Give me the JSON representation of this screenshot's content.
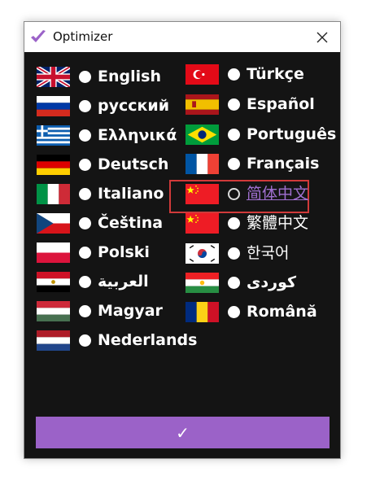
{
  "window": {
    "title": "Optimizer"
  },
  "languages_left": [
    {
      "flag": "uk-flag",
      "label": "English",
      "selected": false
    },
    {
      "flag": "russia-flag",
      "label": "русский",
      "selected": false
    },
    {
      "flag": "greece-flag",
      "label": "Ελληνικά",
      "selected": false
    },
    {
      "flag": "germany-flag",
      "label": "Deutsch",
      "selected": false
    },
    {
      "flag": "italy-flag",
      "label": "Italiano",
      "selected": false
    },
    {
      "flag": "czech-flag",
      "label": "Čeština",
      "selected": false
    },
    {
      "flag": "poland-flag",
      "label": "Polski",
      "selected": false
    },
    {
      "flag": "egypt-flag",
      "label": "العربية",
      "selected": false
    },
    {
      "flag": "hungary-flag",
      "label": "Magyar",
      "selected": false
    },
    {
      "flag": "netherlands-flag",
      "label": "Nederlands",
      "selected": false
    }
  ],
  "languages_right": [
    {
      "flag": "turkey-flag",
      "label": "Türkçe",
      "selected": false
    },
    {
      "flag": "spain-flag",
      "label": "Español",
      "selected": false
    },
    {
      "flag": "brazil-flag",
      "label": "Português",
      "selected": false
    },
    {
      "flag": "france-flag",
      "label": "Français",
      "selected": false
    },
    {
      "flag": "china-flag",
      "label": "简体中文",
      "selected": true
    },
    {
      "flag": "china-flag",
      "label": "繁體中文",
      "selected": false
    },
    {
      "flag": "korea-flag",
      "label": "한국어",
      "selected": false
    },
    {
      "flag": "kurdistan-flag",
      "label": "كوردى",
      "selected": false
    },
    {
      "flag": "romania-flag",
      "label": "Română",
      "selected": false
    }
  ],
  "confirm_button": {
    "label": "✓"
  },
  "colors": {
    "background": "#141414",
    "accent": "#9b62c8",
    "selection_label": "#a070d0",
    "highlight_border": "#d13a3a"
  }
}
